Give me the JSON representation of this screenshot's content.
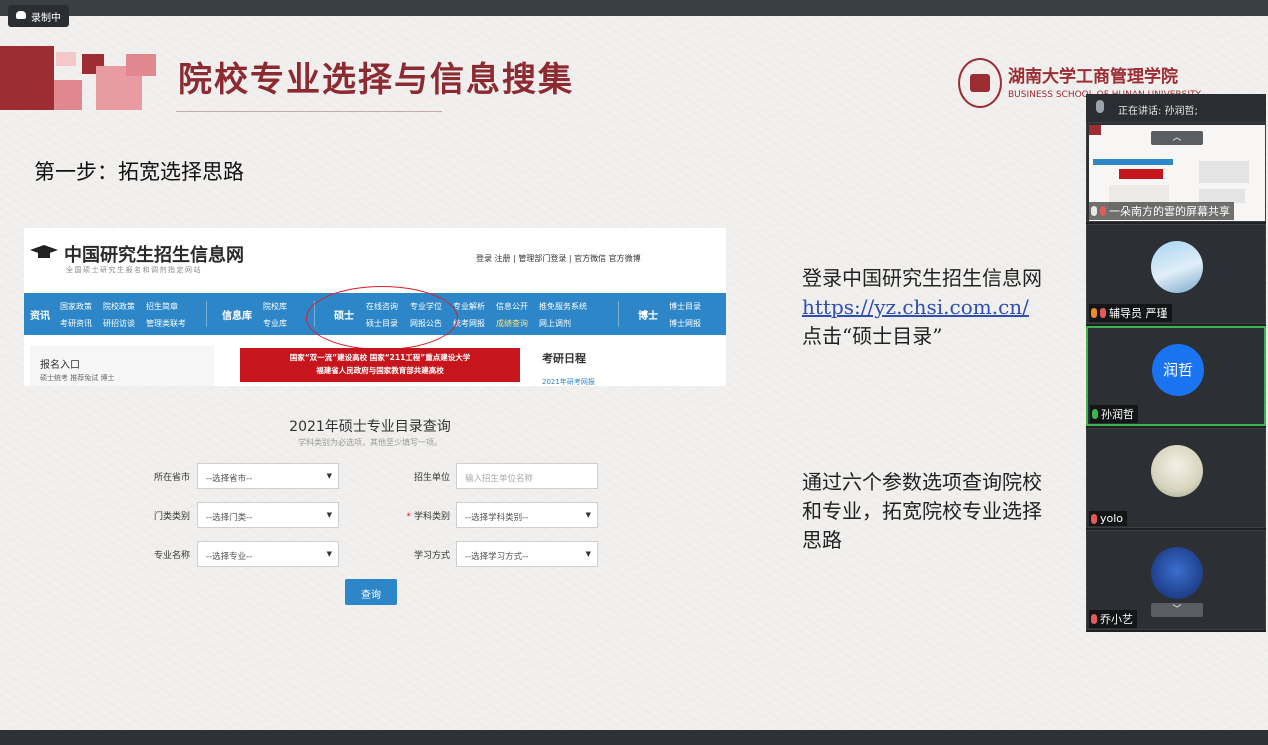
{
  "recording": {
    "label": "录制中"
  },
  "slide": {
    "title": "院校专业选择与信息搜集",
    "logo_cn": "湖南大学工商管理学院",
    "logo_en": "BUSINESS SCHOOL OF HUNAN UNIVERSITY",
    "step_title": "第一步：拓宽选择思路",
    "desc1": {
      "line1": "登录中国研究生招生信息网",
      "url": "https://yz.chsi.com.cn/",
      "line3": "点击“硕士目录”"
    },
    "desc2": {
      "line1": "通过六个参数选项查询院校",
      "line2": "和专业，拓宽院校专业选择",
      "line3": "思路"
    }
  },
  "website": {
    "name": "中国研究生招生信息网",
    "subtitle": "全国硕士研究生报名和调剂指定网站",
    "top_links": "登录  注册  |  管理部门登录  |  官方微信   官方微博",
    "nav": {
      "zixun": "资讯",
      "zixun_items": [
        "国家政策",
        "院校政策",
        "招生简章",
        "考研资讯",
        "研招访谈",
        "管理类联考"
      ],
      "xinxiku": "信息库",
      "xinxiku_items": [
        "院校库",
        "专业库"
      ],
      "shuoshi": "硕士",
      "shuoshi_items": [
        "在线咨询",
        "专业学位",
        "专业解析",
        "信息公开",
        "推免服务系统",
        "硕士目录",
        "网报公告",
        "统考网报",
        "成绩查询",
        "网上调剂"
      ],
      "boshi": "博士",
      "boshi_items": [
        "博士目录",
        "博士网报"
      ]
    },
    "entry_title": "报名入口",
    "entry_sub": "硕士统考   推荐免试   博士",
    "banner_line1": "国家“双一流”建设高校 国家“211工程”重点建设大学",
    "banner_line2": "福建省人民政府与国家教育部共建高校",
    "kaoyan_title": "考研日程",
    "kaoyan_sub": "2021年研考网报"
  },
  "form": {
    "title": "2021年硕士专业目录查询",
    "hint": "学科类别为必选项，其他至少填写一项。",
    "province_label": "所在省市",
    "province_value": "--选择省市--",
    "unit_label": "招生单位",
    "unit_placeholder": "输入招生单位名称",
    "category_label": "门类类别",
    "category_value": "--选择门类--",
    "subject_label": "学科类别",
    "subject_value": "--选择学科类别--",
    "major_label": "专业名称",
    "major_value": "--选择专业--",
    "mode_label": "学习方式",
    "mode_value": "--选择学习方式--",
    "query_button": "查询"
  },
  "meeting": {
    "speaking_label": "正在讲话: 孙润哲;",
    "participants": [
      {
        "name": "一朵南方的雲的屏幕共享"
      },
      {
        "name": "辅导员 严瑾"
      },
      {
        "name": "孙润哲",
        "avatar_text": "润哲"
      },
      {
        "name": "yolo"
      },
      {
        "name": "乔小艺"
      }
    ],
    "scroll_up": "︿",
    "scroll_down": "﹀"
  },
  "colors": {
    "slide_accent": "#8c2a31",
    "site_blue": "#2c86c8",
    "speaker_border": "#3cb44b",
    "avatar_blue": "#1a73f0"
  }
}
